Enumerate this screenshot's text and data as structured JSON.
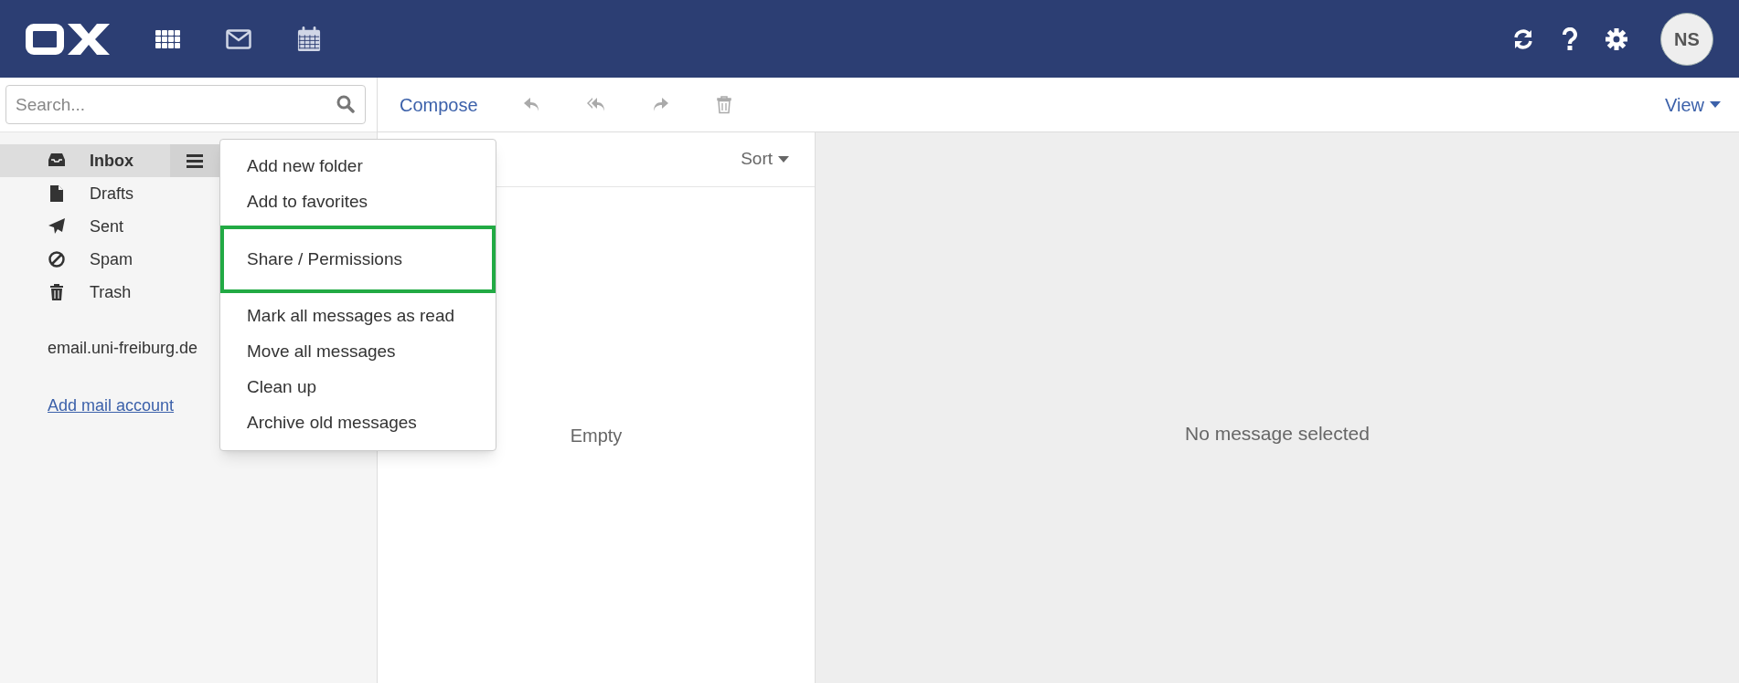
{
  "header": {
    "apps": [
      {
        "kind": "grid"
      },
      {
        "kind": "mail"
      },
      {
        "kind": "calendar"
      }
    ],
    "tools": [
      {
        "kind": "refresh"
      },
      {
        "kind": "help"
      },
      {
        "kind": "settings"
      }
    ],
    "avatar": "NS"
  },
  "search": {
    "placeholder": "Search..."
  },
  "folders": [
    {
      "kind": "inbox",
      "label": "Inbox",
      "selected": true
    },
    {
      "kind": "drafts",
      "label": "Drafts",
      "selected": false
    },
    {
      "kind": "sent",
      "label": "Sent",
      "selected": false
    },
    {
      "kind": "spam",
      "label": "Spam",
      "selected": false
    },
    {
      "kind": "trash",
      "label": "Trash",
      "selected": false
    }
  ],
  "account": "email.uni-freiburg.de",
  "add_account": "Add mail account",
  "toolbar": {
    "compose": "Compose",
    "actions": [
      {
        "kind": "reply",
        "disabled": true
      },
      {
        "kind": "reply-all",
        "disabled": true
      },
      {
        "kind": "forward",
        "disabled": true
      },
      {
        "kind": "delete",
        "disabled": true
      }
    ],
    "view": "View"
  },
  "list": {
    "sort": "Sort",
    "empty": "Empty"
  },
  "detail": {
    "empty": "No message selected"
  },
  "context_menu": [
    {
      "highlighted": false,
      "items": [
        "Add new folder",
        "Add to favorites"
      ]
    },
    {
      "highlighted": true,
      "items": [
        "Share / Permissions"
      ]
    },
    {
      "highlighted": false,
      "items": [
        "Mark all messages as read",
        "Move all messages",
        "Clean up",
        "Archive old messages"
      ]
    }
  ]
}
